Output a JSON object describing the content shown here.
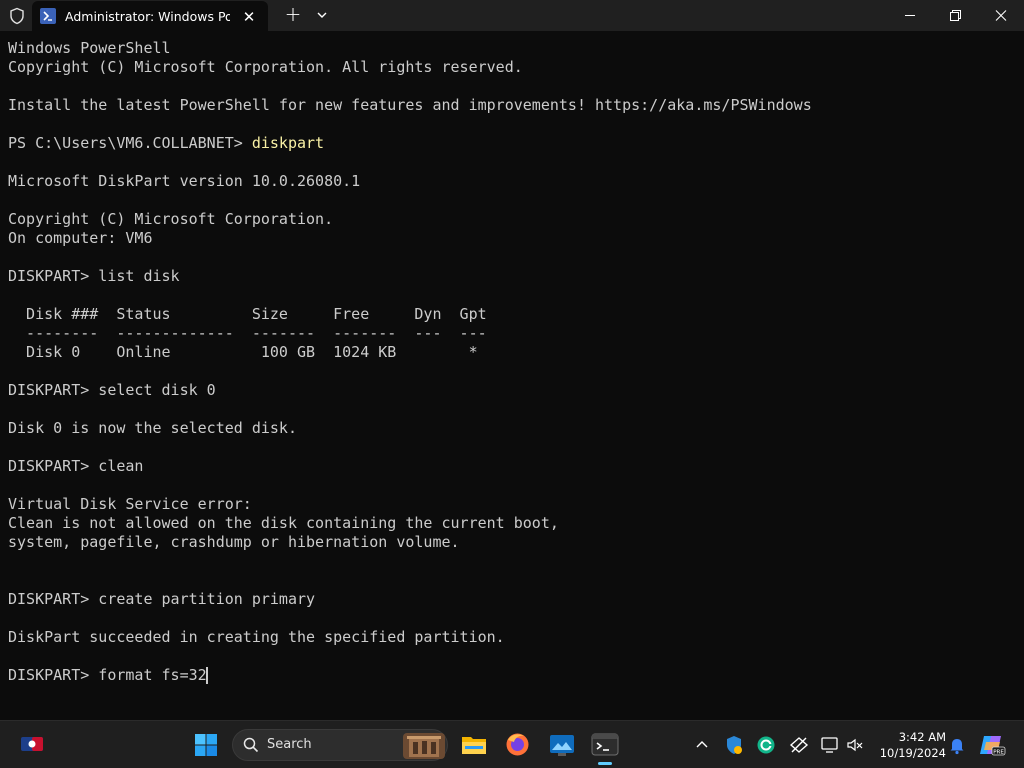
{
  "window": {
    "tab_title": "Administrator: Windows PowerShell",
    "tab_close_glyph": "✕",
    "new_tab_glyph": "+"
  },
  "terminal": {
    "lines": [
      {
        "text": "Windows PowerShell",
        "type": "output"
      },
      {
        "text": "Copyright (C) Microsoft Corporation. All rights reserved.",
        "type": "output"
      },
      {
        "text": "Install the latest PowerShell for new features and improvements! https://aka.ms/PSWindows",
        "type": "output"
      },
      {
        "prompt": "PS C:\\Users\\VM6.COLLABNET> ",
        "command": "diskpart",
        "type": "ps-command"
      },
      {
        "text": "Microsoft DiskPart version 10.0.26080.1",
        "type": "output"
      },
      {
        "text": "Copyright (C) Microsoft Corporation.",
        "type": "output"
      },
      {
        "text": "On computer: VM6",
        "type": "output"
      },
      {
        "text": "DISKPART> list disk",
        "type": "diskpart-command"
      },
      {
        "text": "  Disk ###  Status         Size     Free     Dyn  Gpt",
        "type": "table-header"
      },
      {
        "text": "  --------  -------------  -------  -------  ---  ---",
        "type": "table-rule"
      },
      {
        "text": "  Disk 0    Online          100 GB  1024 KB        *",
        "type": "table-row"
      },
      {
        "text": "DISKPART> select disk 0",
        "type": "diskpart-command"
      },
      {
        "text": "Disk 0 is now the selected disk.",
        "type": "output"
      },
      {
        "text": "DISKPART> clean",
        "type": "diskpart-command"
      },
      {
        "text": "Virtual Disk Service error:",
        "type": "output"
      },
      {
        "text": "Clean is not allowed on the disk containing the current boot,",
        "type": "output"
      },
      {
        "text": "system, pagefile, crashdump or hibernation volume.",
        "type": "output"
      },
      {
        "text": "DISKPART> create partition primary",
        "type": "diskpart-command"
      },
      {
        "text": "DiskPart succeeded in creating the specified partition.",
        "type": "output"
      },
      {
        "text": "DISKPART> format fs=32",
        "type": "diskpart-input"
      }
    ]
  },
  "taskbar": {
    "search_placeholder": "Search",
    "time": "3:42 AM",
    "date": "10/19/2024",
    "pinned_icons": [
      "windows-start-icon",
      "search-icon",
      "file-explorer-icon",
      "firefox-icon",
      "photos-icon",
      "terminal-icon"
    ],
    "tray_icons": [
      "chevron-up-icon",
      "security-shield-icon",
      "edge-icon",
      "network-icon",
      "display-icon",
      "volume-icon",
      "notification-bell-icon",
      "copilot-icon"
    ],
    "colors": {
      "accent": "#60cdff",
      "prompt_command": "#f9f1a5",
      "terminal_text": "#cccccc",
      "terminal_bg": "#0c0c0c"
    }
  }
}
